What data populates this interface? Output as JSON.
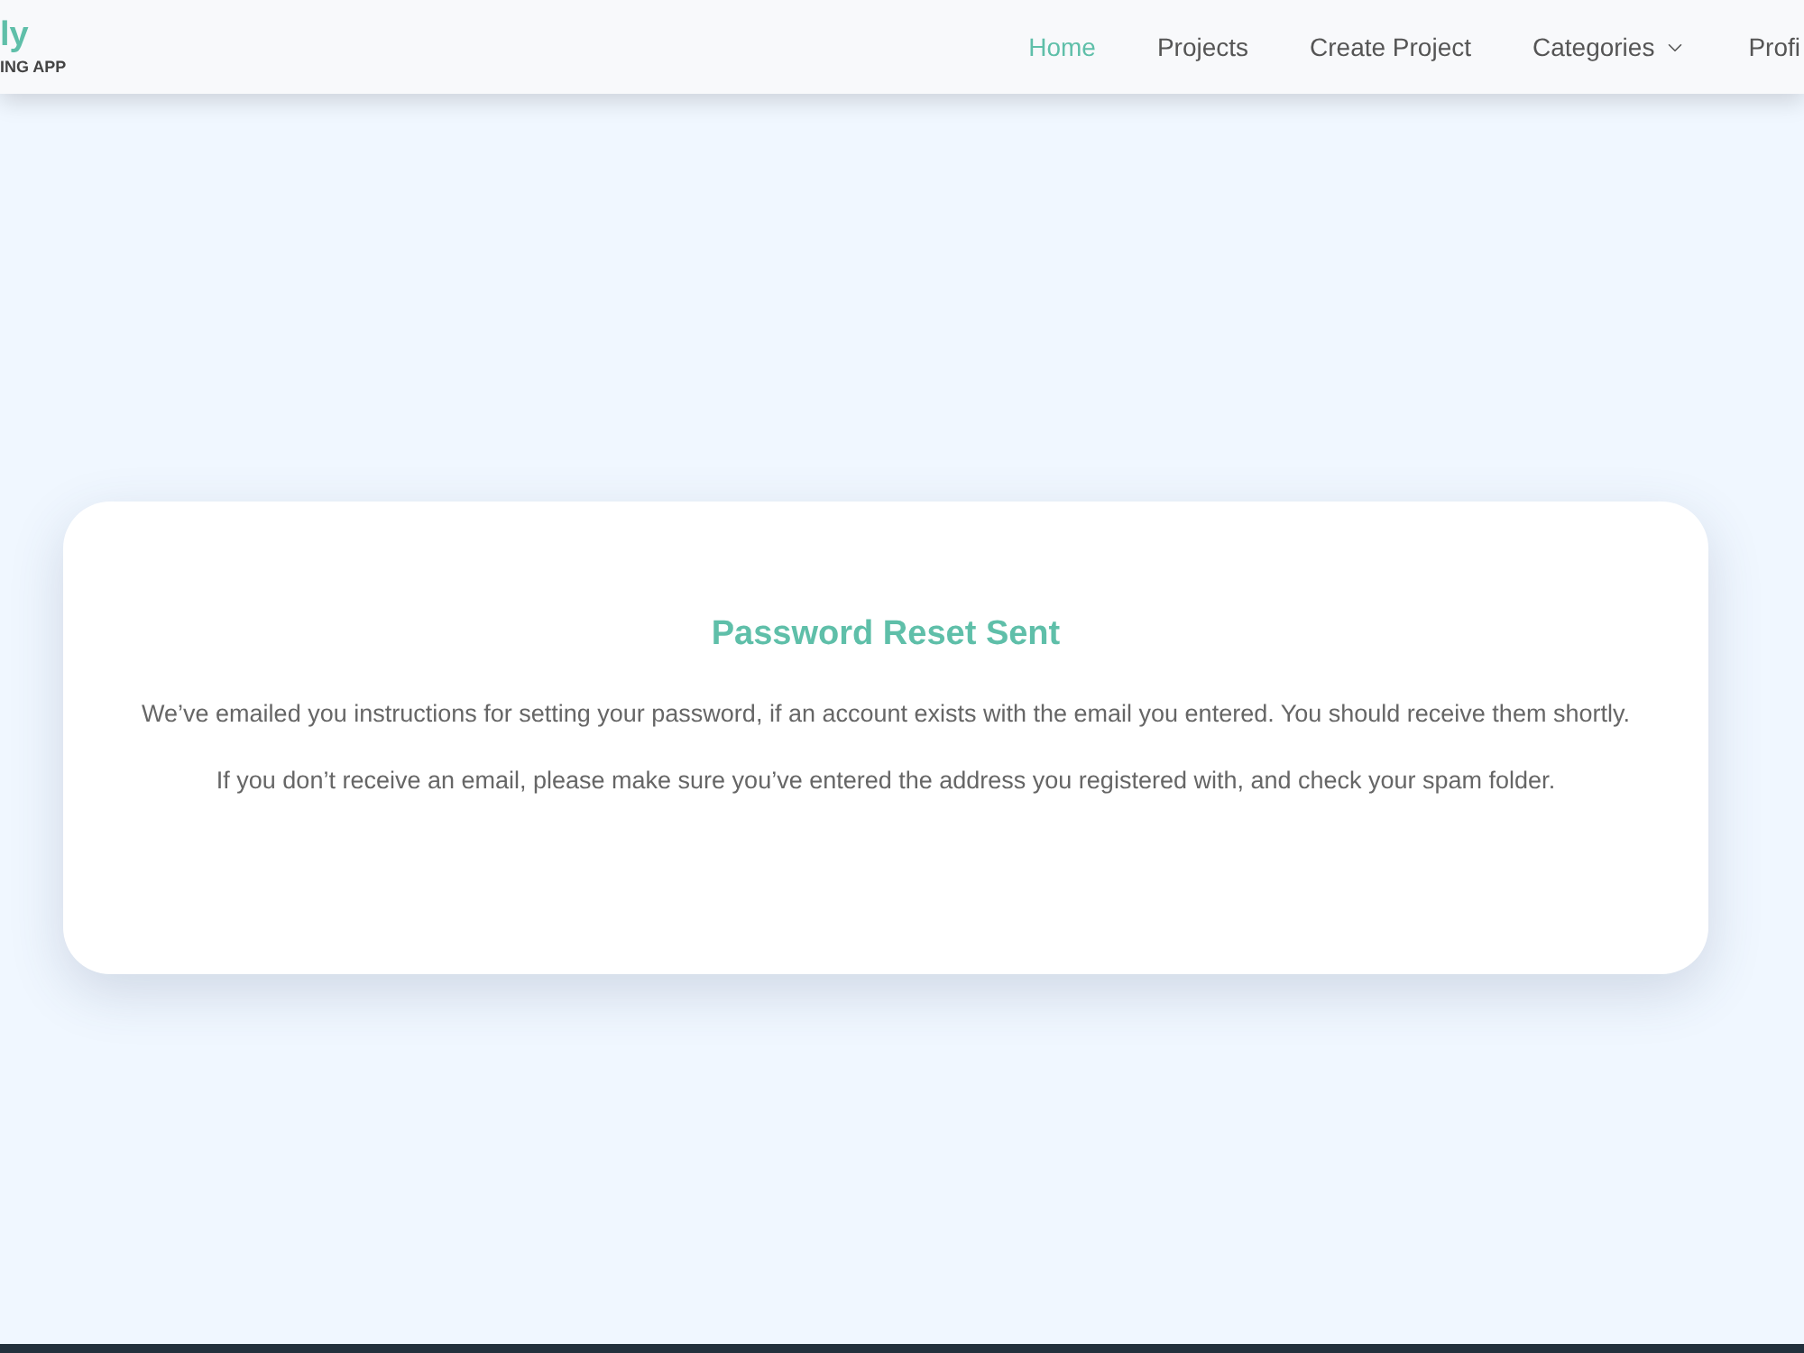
{
  "brand": {
    "name": "ly",
    "tagline": "ING APP"
  },
  "nav": [
    {
      "label": "Home",
      "selected": true,
      "has_menu": false
    },
    {
      "label": "Projects",
      "selected": false,
      "has_menu": false
    },
    {
      "label": "Create Project",
      "selected": false,
      "has_menu": false
    },
    {
      "label": "Categories",
      "selected": false,
      "has_menu": true
    },
    {
      "label": "Profi",
      "selected": false,
      "has_menu": false
    }
  ],
  "card": {
    "title": "Password Reset Sent",
    "paragraphs": [
      "We’ve emailed you instructions for setting your password, if an account exists with the email you entered. You should receive them shortly.",
      "If you don’t receive an email, please make sure you’ve entered the address you registered with, and check your spam folder."
    ]
  }
}
